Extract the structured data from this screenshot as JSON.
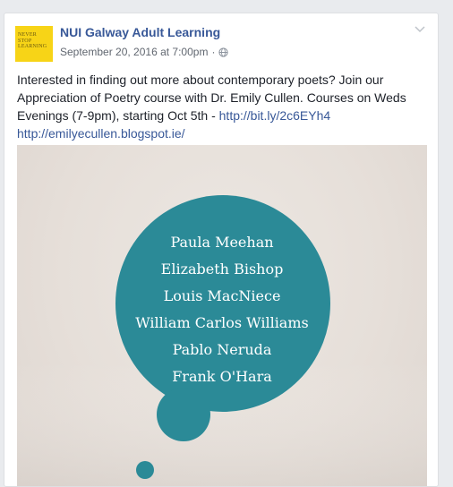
{
  "post": {
    "page_name": "NUI Galway Adult Learning",
    "timestamp": "September 20, 2016 at 7:00pm",
    "separator": "·",
    "privacy_icon": "globe-icon",
    "menu_icon": "chevron-down-icon",
    "avatar_text": [
      "NEVER",
      "STOP",
      "LEARNING"
    ],
    "text": "Interested in finding out more about contemporary poets? Join our Appreciation of Poetry course with Dr. Emily Cullen. Courses on Weds Evenings (7-9pm), starting Oct 5th - ",
    "link1": "http://bit.ly/2c6EYh4",
    "link2": "http://emilyecullen.blogspot.ie/"
  },
  "image": {
    "poets": [
      "Paula Meehan",
      "Elizabeth Bishop",
      "Louis MacNiece",
      "William Carlos Williams",
      "Pablo Neruda",
      "Frank O'Hara"
    ],
    "bubble_color": "#2b8a97"
  }
}
